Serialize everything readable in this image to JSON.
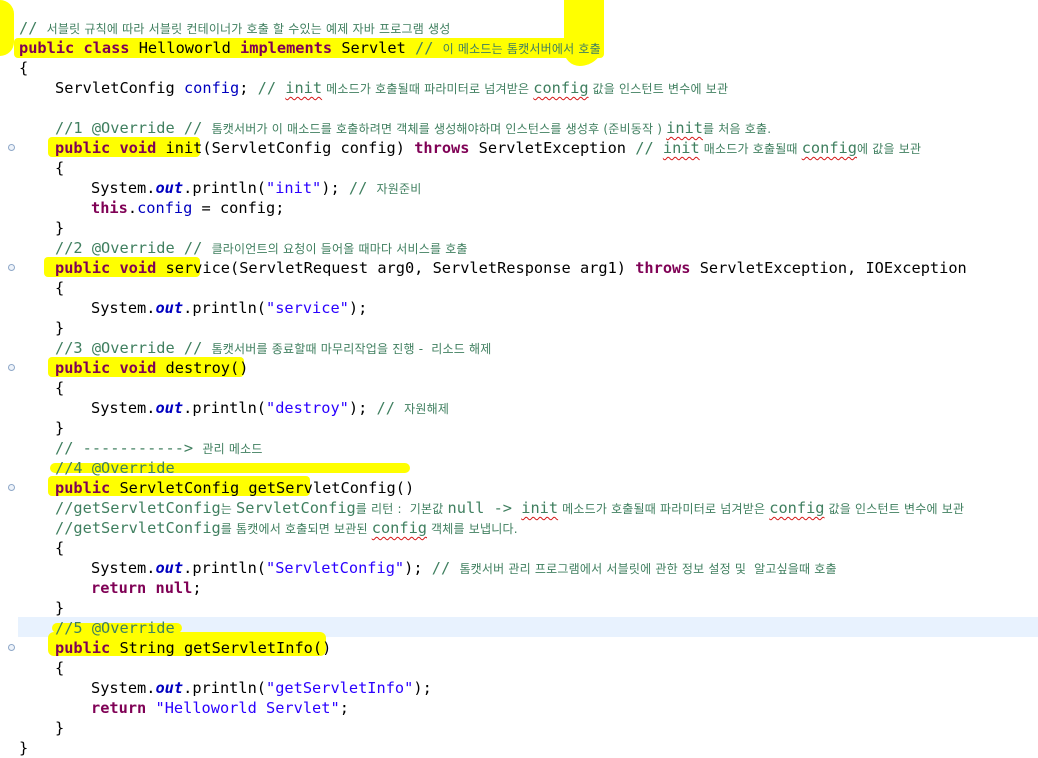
{
  "editor": {
    "highlight_color": "#ffff00",
    "current_line_color": "#e8f2fe",
    "colors": {
      "keyword": "#7f0055",
      "comment": "#3f7f5f",
      "string": "#2a00ff",
      "field": "#0000c0"
    },
    "lines": [
      {
        "indent": 0,
        "tokens": [
          {
            "t": "// ",
            "c": "cm"
          },
          {
            "t": "서블릿 규칙에 따라 서블릿 컨테이너가 호출 할 수있는 예제 자바 프로그램 생성",
            "c": "cm ko"
          }
        ]
      },
      {
        "indent": 0,
        "tokens": [
          {
            "t": "public class",
            "c": "kw"
          },
          {
            "t": " Helloworld "
          },
          {
            "t": "implements",
            "c": "kw"
          },
          {
            "t": " Servlet "
          },
          {
            "t": "// ",
            "c": "cm"
          },
          {
            "t": "이 메소드는 톰캣서버에서 호출",
            "c": "cm ko"
          }
        ]
      },
      {
        "indent": 0,
        "tokens": [
          {
            "t": "{"
          }
        ]
      },
      {
        "indent": 1,
        "tokens": [
          {
            "t": "ServletConfig "
          },
          {
            "t": "config",
            "c": "fld"
          },
          {
            "t": "; "
          },
          {
            "t": "// ",
            "c": "cm"
          },
          {
            "t": "init",
            "c": "cm sq"
          },
          {
            "t": " 메소드가 호출될때 파라미터로 넘겨받은 ",
            "c": "cm ko"
          },
          {
            "t": "config",
            "c": "cm sq"
          },
          {
            "t": " 값을 인스턴트 변수에 보관",
            "c": "cm ko"
          }
        ]
      },
      {
        "indent": 0,
        "tokens": []
      },
      {
        "indent": 1,
        "tokens": [
          {
            "t": "//1 @Override // ",
            "c": "cm"
          },
          {
            "t": "톰캣서버가 이 매소드를 호출하려면 객체를 생성해야하며 인스턴스를 생성후 (준비동작 ) ",
            "c": "cm ko"
          },
          {
            "t": "init",
            "c": "cm sq"
          },
          {
            "t": "를 처음 호출.",
            "c": "cm ko"
          }
        ]
      },
      {
        "indent": 1,
        "tokens": [
          {
            "t": "public void",
            "c": "kw"
          },
          {
            "t": " init(ServletConfig config) "
          },
          {
            "t": "throws",
            "c": "kw"
          },
          {
            "t": " ServletException "
          },
          {
            "t": "// ",
            "c": "cm"
          },
          {
            "t": "init",
            "c": "cm sq"
          },
          {
            "t": " 매소드가 호출될때 ",
            "c": "cm ko"
          },
          {
            "t": "config",
            "c": "cm sq"
          },
          {
            "t": "에 값을 보관",
            "c": "cm ko"
          }
        ]
      },
      {
        "indent": 1,
        "tokens": [
          {
            "t": "{"
          }
        ]
      },
      {
        "indent": 2,
        "tokens": [
          {
            "t": "System."
          },
          {
            "t": "out",
            "c": "sfld"
          },
          {
            "t": ".println("
          },
          {
            "t": "\"init\"",
            "c": "str"
          },
          {
            "t": "); "
          },
          {
            "t": "// ",
            "c": "cm"
          },
          {
            "t": "자원준비",
            "c": "cm ko"
          }
        ]
      },
      {
        "indent": 2,
        "tokens": [
          {
            "t": "this",
            "c": "kw"
          },
          {
            "t": "."
          },
          {
            "t": "config",
            "c": "fld"
          },
          {
            "t": " = config;"
          }
        ]
      },
      {
        "indent": 1,
        "tokens": [
          {
            "t": "}"
          }
        ]
      },
      {
        "indent": 1,
        "tokens": [
          {
            "t": "//2 @Override // ",
            "c": "cm"
          },
          {
            "t": "클라이언트의 요청이 들어올 때마다 서비스를 호출",
            "c": "cm ko"
          }
        ]
      },
      {
        "indent": 1,
        "tokens": [
          {
            "t": "public void",
            "c": "kw"
          },
          {
            "t": " service(ServletRequest arg0, ServletResponse arg1) "
          },
          {
            "t": "throws",
            "c": "kw"
          },
          {
            "t": " ServletException, IOException"
          }
        ]
      },
      {
        "indent": 1,
        "tokens": [
          {
            "t": "{"
          }
        ]
      },
      {
        "indent": 2,
        "tokens": [
          {
            "t": "System."
          },
          {
            "t": "out",
            "c": "sfld"
          },
          {
            "t": ".println("
          },
          {
            "t": "\"service\"",
            "c": "str"
          },
          {
            "t": ");"
          }
        ]
      },
      {
        "indent": 1,
        "tokens": [
          {
            "t": "}"
          }
        ]
      },
      {
        "indent": 1,
        "tokens": [
          {
            "t": "//3 @Override // ",
            "c": "cm"
          },
          {
            "t": "톰캣서버를 종료할때 마무리작업을 진행 -  리소드 해제",
            "c": "cm ko"
          }
        ]
      },
      {
        "indent": 1,
        "tokens": [
          {
            "t": "public void",
            "c": "kw"
          },
          {
            "t": " destroy()"
          }
        ]
      },
      {
        "indent": 1,
        "tokens": [
          {
            "t": "{"
          }
        ]
      },
      {
        "indent": 2,
        "tokens": [
          {
            "t": "System."
          },
          {
            "t": "out",
            "c": "sfld"
          },
          {
            "t": ".println("
          },
          {
            "t": "\"destroy\"",
            "c": "str"
          },
          {
            "t": "); "
          },
          {
            "t": "// ",
            "c": "cm"
          },
          {
            "t": "자원해제",
            "c": "cm ko"
          }
        ]
      },
      {
        "indent": 1,
        "tokens": [
          {
            "t": "}"
          }
        ]
      },
      {
        "indent": 1,
        "tokens": [
          {
            "t": "// -----------> ",
            "c": "cm"
          },
          {
            "t": "관리 메소드",
            "c": "cm ko"
          }
        ]
      },
      {
        "indent": 1,
        "tokens": [
          {
            "t": "//4 @Override",
            "c": "cm"
          }
        ]
      },
      {
        "indent": 1,
        "tokens": [
          {
            "t": "public",
            "c": "kw"
          },
          {
            "t": " ServletConfig getServletConfig()"
          }
        ]
      },
      {
        "indent": 1,
        "tokens": [
          {
            "t": "//getServletConfig",
            "c": "cm"
          },
          {
            "t": "는 ",
            "c": "cm ko"
          },
          {
            "t": "ServletConfig",
            "c": "cm"
          },
          {
            "t": "를 리턴 :  기본값 ",
            "c": "cm ko"
          },
          {
            "t": "null -> ",
            "c": "cm"
          },
          {
            "t": "init",
            "c": "cm sq"
          },
          {
            "t": " 메소드가 호출될때 파라미터로 넘겨받은 ",
            "c": "cm ko"
          },
          {
            "t": "config",
            "c": "cm sq"
          },
          {
            "t": " 값을 인스턴트 변수에 보관",
            "c": "cm ko"
          }
        ]
      },
      {
        "indent": 1,
        "tokens": [
          {
            "t": "//getServletConfig",
            "c": "cm"
          },
          {
            "t": "를 톰캣에서 호출되면 보관된 ",
            "c": "cm ko"
          },
          {
            "t": "config",
            "c": "cm sq"
          },
          {
            "t": " 객체를 보냅니다.",
            "c": "cm ko"
          }
        ]
      },
      {
        "indent": 1,
        "tokens": [
          {
            "t": "{"
          }
        ]
      },
      {
        "indent": 2,
        "tokens": [
          {
            "t": "System."
          },
          {
            "t": "out",
            "c": "sfld"
          },
          {
            "t": ".println("
          },
          {
            "t": "\"ServletConfig\"",
            "c": "str"
          },
          {
            "t": "); "
          },
          {
            "t": "// ",
            "c": "cm"
          },
          {
            "t": "톰캣서버 관리 프로그램에서 서블릿에 관한 정보 설정 및  알고싶을때 호출",
            "c": "cm ko"
          }
        ]
      },
      {
        "indent": 2,
        "tokens": [
          {
            "t": "return",
            "c": "kw"
          },
          {
            "t": " "
          },
          {
            "t": "null",
            "c": "kw"
          },
          {
            "t": ";"
          }
        ]
      },
      {
        "indent": 1,
        "tokens": [
          {
            "t": "}"
          }
        ]
      },
      {
        "indent": 1,
        "tokens": [
          {
            "t": "//5 @Override",
            "c": "cm"
          }
        ]
      },
      {
        "indent": 1,
        "tokens": [
          {
            "t": "public",
            "c": "kw"
          },
          {
            "t": " String getServletInfo()"
          }
        ]
      },
      {
        "indent": 1,
        "tokens": [
          {
            "t": "{"
          }
        ]
      },
      {
        "indent": 2,
        "tokens": [
          {
            "t": "System."
          },
          {
            "t": "out",
            "c": "sfld"
          },
          {
            "t": ".println("
          },
          {
            "t": "\"getServletInfo\"",
            "c": "str"
          },
          {
            "t": ");"
          }
        ]
      },
      {
        "indent": 2,
        "tokens": [
          {
            "t": "return",
            "c": "kw"
          },
          {
            "t": " "
          },
          {
            "t": "\"Helloworld Servlet\"",
            "c": "str"
          },
          {
            "t": ";"
          }
        ]
      },
      {
        "indent": 1,
        "tokens": [
          {
            "t": "}"
          }
        ]
      },
      {
        "indent": 0,
        "tokens": [
          {
            "t": "}"
          }
        ]
      }
    ]
  }
}
